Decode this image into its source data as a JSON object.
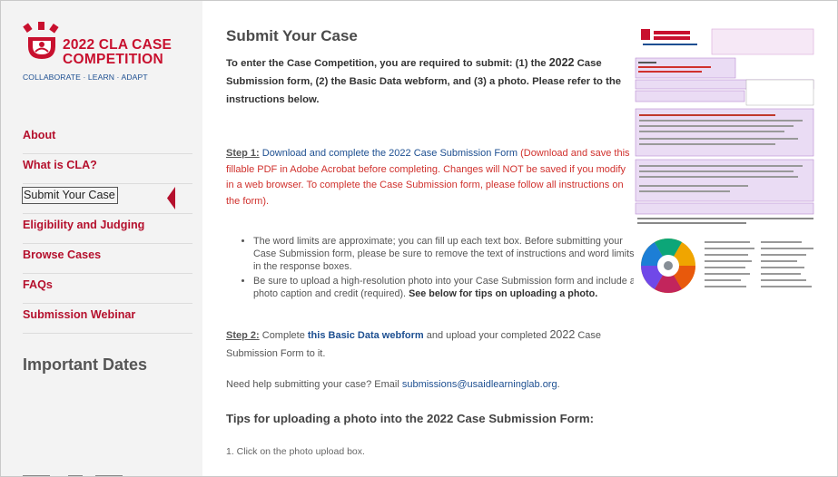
{
  "logo": {
    "line1": "2022 CLA CASE",
    "line2": "COMPETITION",
    "tagline": "COLLABORATE · LEARN · ADAPT"
  },
  "sidebar": {
    "items": [
      {
        "label": "About"
      },
      {
        "label": "What is CLA?"
      },
      {
        "label": "Submit Your Case"
      },
      {
        "label": "Eligibility and Judging"
      },
      {
        "label": "Browse Cases"
      },
      {
        "label": "FAQs"
      },
      {
        "label": "Submission Webinar"
      }
    ],
    "important_dates": "Important Dates"
  },
  "main": {
    "title": "Submit Your Case",
    "intro_a": "To enter the Case Competition, you are required to submit: (1) the ",
    "intro_year": "2022",
    "intro_b": " Case Submission form, (2) the Basic Data webform, and (3) a photo. Please refer to the instructions below.",
    "step1_label": "Step 1:",
    "step1_a": " Download and complete the ",
    "step1_year": "2022",
    "step1_b": " Case Submission Form",
    "step1_c": " (Download and save this fillable PDF in Adobe Acrobat before completing. Changes will NOT be saved if you modify in a web browser. To complete the Case Submission form, please follow all instructions on the form).",
    "bullet1": "The word limits are approximate; you can fill up each text box. Before submitting your Case Submission form, please be sure to remove the text of instructions and word limits in the response boxes.",
    "bullet2_a": "Be sure to upload a high-resolution photo into your Case Submission form and include a photo caption and credit (required). ",
    "bullet2_b": "See below for tips on uploading a photo.",
    "step2_label": "Step 2:",
    "step2_a": " Complete ",
    "step2_link": "this Basic Data webform",
    "step2_b": " and upload your completed ",
    "step2_year": "2022",
    "step2_c": " Case Submission Form to it.",
    "help_a": "Need help submitting your case? Email ",
    "help_email": "submissions@usaidlearninglab.org",
    "help_b": ".",
    "tips_a": "Tips for uploading a photo into the ",
    "tips_year": "2022",
    "tips_b": " Case Submission Form:",
    "tip1": "1. Click on the photo upload box."
  },
  "colors": {
    "brand_red": "#c8102e",
    "link_blue": "#1d4f91",
    "sidebar_bg": "#f3f3f3"
  },
  "icons": {
    "logo": "cla-logo-icon",
    "active_marker": "active-nav-marker-icon"
  }
}
